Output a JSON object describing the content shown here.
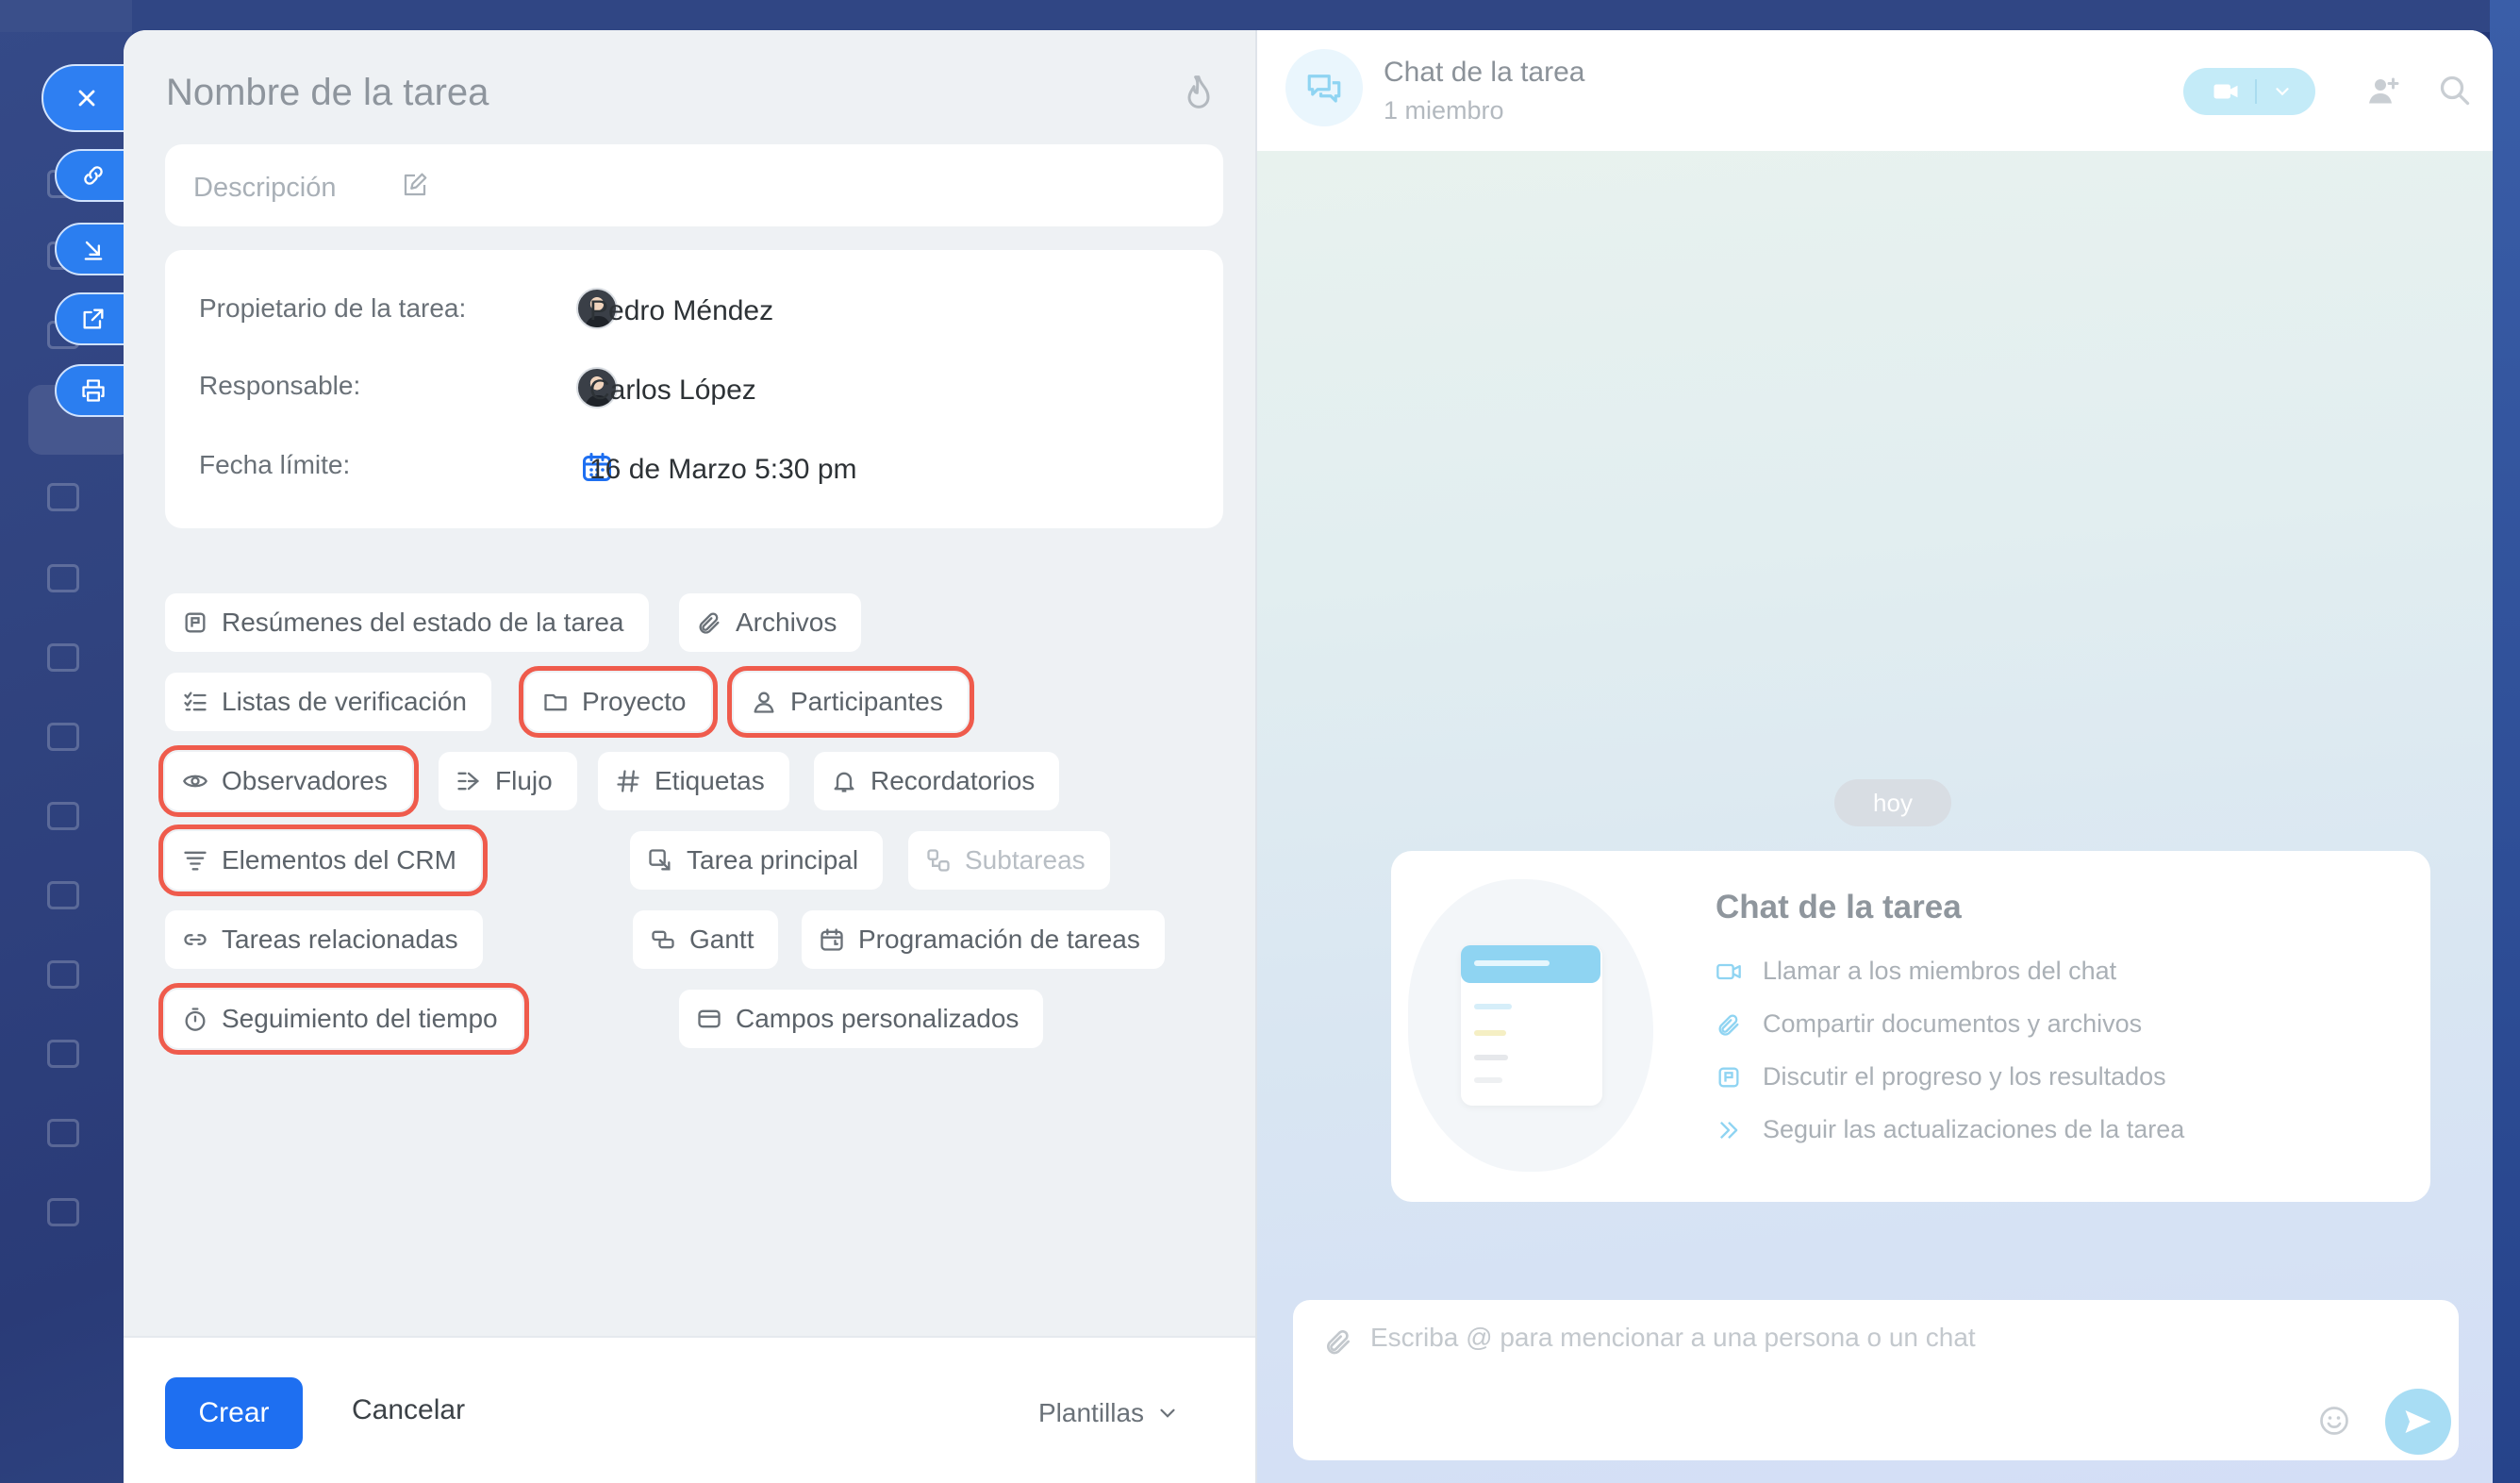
{
  "task": {
    "name_placeholder": "Nombre de la tarea",
    "description_placeholder": "Descripción"
  },
  "info": {
    "owner_label": "Propietario de la tarea:",
    "owner_name": "Pedro Méndez",
    "responsible_label": "Responsable:",
    "responsible_name": "Carlos López",
    "deadline_label": "Fecha límite:",
    "deadline_value": "16 de Marzo 5:30 pm"
  },
  "chips": {
    "resumenes": "Resúmenes del estado de la tarea",
    "archivos": "Archivos",
    "listas": "Listas de verificación",
    "proyecto": "Proyecto",
    "participantes": "Participantes",
    "observadores": "Observadores",
    "flujo": "Flujo",
    "etiquetas": "Etiquetas",
    "recordatorios": "Recordatorios",
    "crm": "Elementos del CRM",
    "tarea_principal": "Tarea principal",
    "subtareas": "Subtareas",
    "relacionadas": "Tareas relacionadas",
    "gantt": "Gantt",
    "programacion": "Programación de tareas",
    "seguimiento": "Seguimiento del tiempo",
    "campos": "Campos personalizados"
  },
  "footer": {
    "create": "Crear",
    "cancel": "Cancelar",
    "templates": "Plantillas"
  },
  "chat": {
    "title": "Chat de la tarea",
    "members": "1 miembro",
    "day": "hoy",
    "intro_title": "Chat de la tarea",
    "intro_items": [
      "Llamar a los miembros del chat",
      "Compartir documentos y archivos",
      "Discutir el progreso y los resultados",
      "Seguir las actualizaciones de la tarea"
    ],
    "composer_placeholder": "Escriba @ para mencionar a una persona o un chat"
  },
  "colors": {
    "accent": "#1e6ff1",
    "highlight": "#ef5b4c",
    "chat_accent": "#8fd4f2"
  }
}
